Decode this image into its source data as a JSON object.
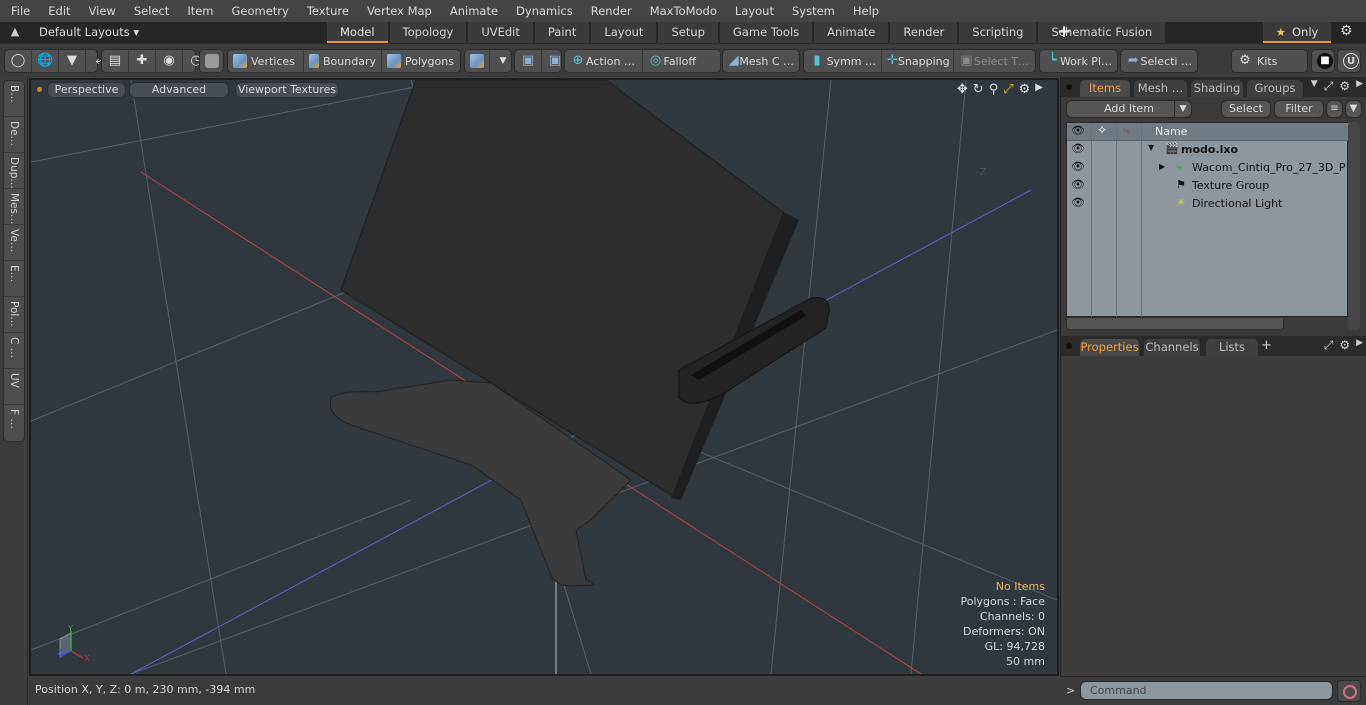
{
  "menu": [
    "File",
    "Edit",
    "View",
    "Select",
    "Item",
    "Geometry",
    "Texture",
    "Vertex Map",
    "Animate",
    "Dynamics",
    "Render",
    "MaxToModo",
    "Layout",
    "System",
    "Help"
  ],
  "layoutbar": {
    "layouts_label": "Default Layouts ▾",
    "tabs": [
      "Model",
      "Topology",
      "UVEdit",
      "Paint",
      "Layout",
      "Setup",
      "Game Tools",
      "Animate",
      "Render",
      "Scripting",
      "Schematic Fusion"
    ],
    "active_tab": "Model",
    "add_tab": "+",
    "only_label": "Only",
    "accent_color": "#e79a2a"
  },
  "toolbar": {
    "vertices": "Vertices",
    "boundary": "Boundary",
    "polygons": "Polygons",
    "action": "Action  …",
    "falloff": "Falloff",
    "mesh_c": "Mesh C …",
    "symm": "Symm …",
    "snapping": "Snapping",
    "select_t": "Select T…",
    "work_pl": "Work Pl…",
    "selecti": "Selecti …",
    "kits": "Kits"
  },
  "left_tabs": [
    "B…",
    "De…",
    "Dup…",
    "Mes…",
    "Ve…",
    "E…",
    "Pol…",
    "C …",
    "UV",
    "F …"
  ],
  "viewport": {
    "view_mode": "Perspective",
    "shading": "Advanced",
    "textures": "Viewport Textures",
    "axis_label_minus_z": "-Z",
    "hud": {
      "selection": "No Items",
      "mode": "Polygons : Face",
      "channels": "Channels: 0",
      "deformers": "Deformers: ON",
      "gl": "GL: 94,728",
      "grid": "50 mm"
    },
    "gizmo": {
      "x": "X",
      "y": "Y",
      "z": "Z"
    }
  },
  "statusbar": {
    "position": "Position X, Y, Z:   0 m, 230 mm, -394 mm"
  },
  "items_panel": {
    "tabs": [
      "Items",
      "Mesh …",
      "Shading",
      "Groups"
    ],
    "active_tab": "Items",
    "add_item": "Add Item",
    "select": "Select",
    "filter": "Filter",
    "name_header": "Name",
    "items": [
      {
        "name": "modo.lxo",
        "bold": true
      },
      {
        "name": "Wacom_Cintiq_Pro_27_3D_P …",
        "bold": false
      },
      {
        "name": "Texture Group",
        "bold": false
      },
      {
        "name": "Directional Light",
        "bold": false
      }
    ]
  },
  "properties_panel": {
    "tabs": [
      "Properties",
      "Channels",
      "Lists"
    ],
    "active_tab": "Properties",
    "add_tab": "+"
  },
  "command": {
    "prompt": ">",
    "placeholder": "Command"
  }
}
